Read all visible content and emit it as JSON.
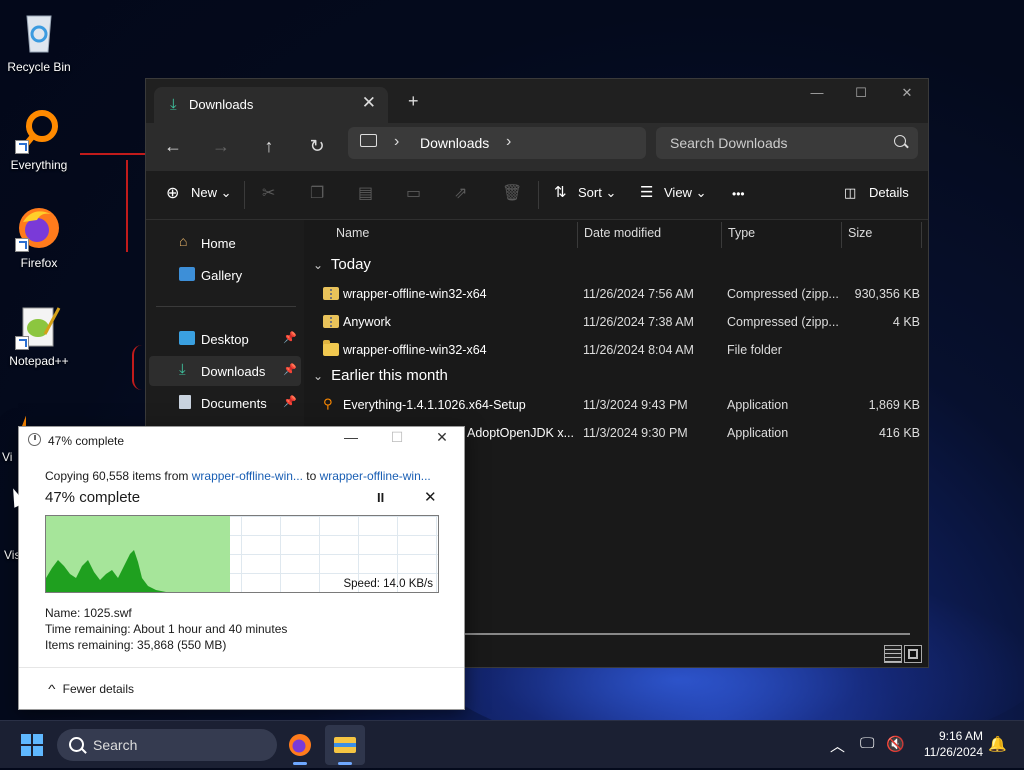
{
  "desktop": {
    "icons": [
      {
        "label": "Recycle Bin"
      },
      {
        "label": "Everything"
      },
      {
        "label": "Firefox"
      },
      {
        "label": "Notepad++"
      },
      {
        "label": "Vi"
      },
      {
        "label": "Vis"
      }
    ]
  },
  "explorer": {
    "tab_title": "Downloads",
    "tab_close": "✕",
    "new_tab": "+",
    "window_controls": {
      "minimize": "—",
      "maximize": "☐",
      "close": "✕"
    },
    "nav": {
      "back": "←",
      "forward": "→",
      "up": "↑",
      "refresh": "↻"
    },
    "address": {
      "sep1": "›",
      "location": "Downloads",
      "sep2": "›"
    },
    "search_placeholder": "Search Downloads",
    "toolbar": {
      "new_label": "New",
      "sort_label": "Sort",
      "view_label": "View",
      "more_label": "•••",
      "details_label": "Details"
    },
    "sidebar": {
      "items": [
        {
          "label": "Home"
        },
        {
          "label": "Gallery"
        },
        {
          "label": "Desktop"
        },
        {
          "label": "Downloads"
        },
        {
          "label": "Documents"
        }
      ]
    },
    "columns": {
      "name": "Name",
      "date": "Date modified",
      "type": "Type",
      "size": "Size"
    },
    "groups": [
      {
        "label": "Today",
        "files": [
          {
            "name": "wrapper-offline-win32-x64",
            "date": "11/26/2024 7:56 AM",
            "type": "Compressed (zipp...",
            "size": "930,356 KB",
            "icon": "zip-icon"
          },
          {
            "name": "Anywork",
            "date": "11/26/2024 7:38 AM",
            "type": "Compressed (zipp...",
            "size": "4 KB",
            "icon": "zip-icon"
          },
          {
            "name": "wrapper-offline-win32-x64",
            "date": "11/26/2024 8:04 AM",
            "type": "File folder",
            "size": "",
            "icon": "folder-icon"
          }
        ]
      },
      {
        "label": "Earlier this month",
        "files": [
          {
            "name": "Everything-1.4.1.1026.x64-Setup",
            "date": "11/3/2024 9:43 PM",
            "type": "Application",
            "size": "1,869 KB",
            "icon": "everything-icon"
          },
          {
            "name": "AdoptOpenJDK x...",
            "date": "11/3/2024 9:30 PM",
            "type": "Application",
            "size": "416 KB",
            "icon": "app-icon"
          }
        ]
      }
    ]
  },
  "copy_dialog": {
    "title": "47% complete",
    "window_controls": {
      "minimize": "—",
      "maximize": "☐",
      "close": "✕"
    },
    "copy_prefix": "Copying 60,558 items from ",
    "source": "wrapper-offline-win...",
    "copy_mid": " to ",
    "destination": "wrapper-offline-win...",
    "percent_text": "47% complete",
    "progress": 0.47,
    "pause_label": "II",
    "stop_label": "✕",
    "speed": "Speed: 14.0 KB/s",
    "name_line": "Name:  1025.swf",
    "time_line": "Time remaining:  About 1 hour and 40 minutes",
    "items_line": "Items remaining:  35,868 (550 MB)",
    "fewer_details": "Fewer details",
    "fewer_caret": "^"
  },
  "taskbar": {
    "search_text": "Search",
    "time": "9:16 AM",
    "date": "11/26/2024",
    "colors": {
      "accent": "#5fb8ff"
    }
  }
}
